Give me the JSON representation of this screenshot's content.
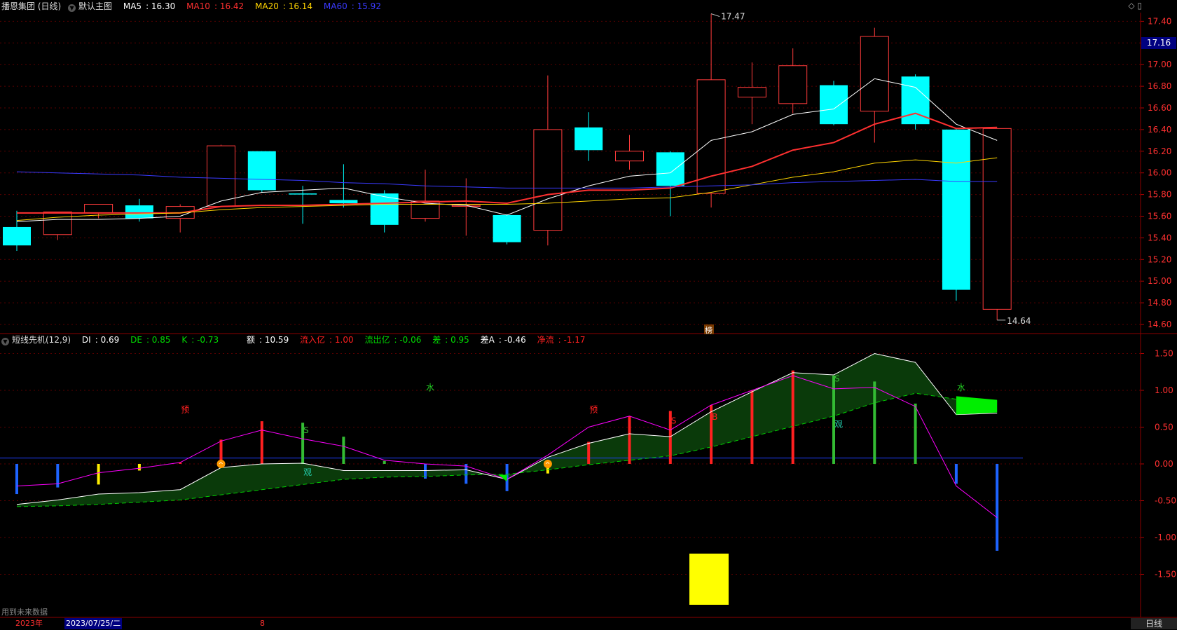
{
  "main": {
    "title": "播恩集团 (日线)",
    "template": "默认主图",
    "ma": [
      {
        "label": "MA5",
        "value": "16.30",
        "color": "#ffffff"
      },
      {
        "label": "MA10",
        "value": "16.42",
        "color": "#ff3030"
      },
      {
        "label": "MA20",
        "value": "16.14",
        "color": "#ffd400"
      },
      {
        "label": "MA60",
        "value": "15.92",
        "color": "#3a3aff"
      }
    ],
    "current_price": "17.16",
    "high_label": "17.47",
    "low_label": "14.64",
    "marker_text": "榜"
  },
  "indicator": {
    "title": "短线先机(12,9)",
    "values": [
      {
        "label": "DI",
        "value": "0.69"
      },
      {
        "label": "DE",
        "value": "0.85"
      },
      {
        "label": "K",
        "value": "-0.73"
      },
      {
        "label": "额",
        "value": "10.59"
      },
      {
        "label": "流入亿",
        "value": "1.00"
      },
      {
        "label": "流出亿",
        "value": "-0.06"
      },
      {
        "label": "差",
        "value": "0.95"
      },
      {
        "label": "差A",
        "value": "-0.46"
      },
      {
        "label": "净流",
        "value": "-1.17"
      }
    ]
  },
  "footer": {
    "note": "用到未来数据",
    "year": "2023年",
    "cursor_date": "2023/07/25/二",
    "month": "8",
    "period": "日线"
  },
  "chart_data": [
    {
      "type": "candlestick",
      "title": "播恩集团 (日线)",
      "ylim": [
        14.5,
        17.5
      ],
      "yticks": [
        14.6,
        14.8,
        15.0,
        15.2,
        15.4,
        15.6,
        15.8,
        16.0,
        16.2,
        16.4,
        16.6,
        16.8,
        17.0,
        17.2,
        17.4
      ],
      "candles": [
        {
          "o": 15.5,
          "h": 15.65,
          "l": 15.28,
          "c": 15.33
        },
        {
          "o": 15.43,
          "h": 15.64,
          "l": 15.38,
          "c": 15.64
        },
        {
          "o": 15.63,
          "h": 15.71,
          "l": 15.58,
          "c": 15.71
        },
        {
          "o": 15.7,
          "h": 15.76,
          "l": 15.55,
          "c": 15.58
        },
        {
          "o": 15.58,
          "h": 15.71,
          "l": 15.45,
          "c": 15.69
        },
        {
          "o": 15.69,
          "h": 16.26,
          "l": 15.69,
          "c": 16.25
        },
        {
          "o": 16.2,
          "h": 16.2,
          "l": 15.82,
          "c": 15.84
        },
        {
          "o": 15.81,
          "h": 15.88,
          "l": 15.53,
          "c": 15.8
        },
        {
          "o": 15.75,
          "h": 16.08,
          "l": 15.68,
          "c": 15.72
        },
        {
          "o": 15.81,
          "h": 15.84,
          "l": 15.45,
          "c": 15.52
        },
        {
          "o": 15.58,
          "h": 16.03,
          "l": 15.55,
          "c": 15.74
        },
        {
          "o": 15.7,
          "h": 15.95,
          "l": 15.42,
          "c": 15.7
        },
        {
          "o": 15.61,
          "h": 15.62,
          "l": 15.34,
          "c": 15.36
        },
        {
          "o": 15.47,
          "h": 16.9,
          "l": 15.33,
          "c": 16.4
        },
        {
          "o": 16.42,
          "h": 16.56,
          "l": 16.11,
          "c": 16.21
        },
        {
          "o": 16.11,
          "h": 16.35,
          "l": 16.03,
          "c": 16.2
        },
        {
          "o": 16.19,
          "h": 16.2,
          "l": 15.6,
          "c": 15.88
        },
        {
          "o": 15.81,
          "h": 17.47,
          "l": 15.68,
          "c": 16.86
        },
        {
          "o": 16.7,
          "h": 17.02,
          "l": 16.45,
          "c": 16.79
        },
        {
          "o": 16.64,
          "h": 17.15,
          "l": 16.55,
          "c": 16.99
        },
        {
          "o": 16.81,
          "h": 16.85,
          "l": 16.44,
          "c": 16.45
        },
        {
          "o": 16.57,
          "h": 17.34,
          "l": 16.28,
          "c": 17.26
        },
        {
          "o": 16.89,
          "h": 16.91,
          "l": 16.4,
          "c": 16.45
        },
        {
          "o": 16.4,
          "h": 16.41,
          "l": 14.82,
          "c": 14.92
        },
        {
          "o": 14.74,
          "h": 16.41,
          "l": 14.64,
          "c": 16.41
        }
      ],
      "series": [
        {
          "name": "MA5",
          "color": "#ffffff",
          "values": [
            15.55,
            15.57,
            15.57,
            15.58,
            15.6,
            15.74,
            15.82,
            15.84,
            15.86,
            15.78,
            15.72,
            15.7,
            15.61,
            15.76,
            15.88,
            15.97,
            16.0,
            16.3,
            16.38,
            16.54,
            16.59,
            16.87,
            16.79,
            16.45,
            16.3
          ]
        },
        {
          "name": "MA10",
          "color": "#ff3030",
          "values": [
            15.63,
            15.63,
            15.63,
            15.63,
            15.63,
            15.69,
            15.7,
            15.7,
            15.71,
            15.72,
            15.73,
            15.74,
            15.72,
            15.8,
            15.84,
            15.84,
            15.86,
            15.97,
            16.06,
            16.21,
            16.28,
            16.45,
            16.55,
            16.41,
            16.42
          ]
        },
        {
          "name": "MA20",
          "color": "#ffd400",
          "values": [
            15.56,
            15.59,
            15.61,
            15.62,
            15.63,
            15.66,
            15.68,
            15.69,
            15.7,
            15.71,
            15.71,
            15.71,
            15.71,
            15.72,
            15.74,
            15.76,
            15.77,
            15.82,
            15.89,
            15.96,
            16.01,
            16.09,
            16.12,
            16.09,
            16.14
          ]
        },
        {
          "name": "MA60",
          "color": "#3a3aff",
          "values": [
            16.01,
            16.0,
            15.99,
            15.98,
            15.96,
            15.95,
            15.94,
            15.93,
            15.91,
            15.9,
            15.88,
            15.87,
            15.86,
            15.86,
            15.86,
            15.86,
            15.87,
            15.88,
            15.89,
            15.91,
            15.92,
            15.93,
            15.94,
            15.92,
            15.92
          ]
        }
      ]
    },
    {
      "type": "indicator",
      "title": "短线先机(12,9)",
      "ylim": [
        -2.0,
        1.65
      ],
      "yticks": [
        -1.5,
        -1.0,
        -0.5,
        0.0,
        0.5,
        1.0,
        1.5
      ],
      "baseline": 0.08,
      "series": [
        {
          "name": "DI",
          "color": "#ffffff",
          "values": [
            -0.55,
            -0.49,
            -0.41,
            -0.39,
            -0.35,
            -0.05,
            0.0,
            0.01,
            -0.09,
            -0.09,
            -0.09,
            -0.08,
            -0.21,
            0.09,
            0.28,
            0.41,
            0.37,
            0.71,
            0.98,
            1.24,
            1.21,
            1.5,
            1.38,
            0.67,
            0.69
          ]
        },
        {
          "name": "DE",
          "color": "#00cc00",
          "values": [
            -0.58,
            -0.57,
            -0.55,
            -0.52,
            -0.49,
            -0.42,
            -0.35,
            -0.28,
            -0.21,
            -0.18,
            -0.17,
            -0.15,
            -0.14,
            -0.08,
            -0.01,
            0.05,
            0.11,
            0.23,
            0.37,
            0.51,
            0.65,
            0.83,
            0.96,
            0.88,
            0.85
          ]
        },
        {
          "name": "K",
          "color": "#ff00ff",
          "values": [
            -0.3,
            -0.27,
            -0.12,
            -0.06,
            0.02,
            0.31,
            0.46,
            0.34,
            0.24,
            0.05,
            0.0,
            -0.03,
            -0.21,
            0.12,
            0.5,
            0.65,
            0.46,
            0.8,
            1.0,
            1.2,
            1.02,
            1.04,
            0.78,
            -0.3,
            -0.73
          ]
        }
      ],
      "bars": [
        {
          "v": -0.41,
          "color": "#1e64ff"
        },
        {
          "v": -0.32,
          "color": "#1e64ff"
        },
        {
          "v": -0.28,
          "color": "#ffee00"
        },
        {
          "v": -0.09,
          "color": "#ffee00"
        },
        {
          "v": 0.02,
          "color": "#ff2020"
        },
        {
          "v": 0.33,
          "color": "#ff2020"
        },
        {
          "v": 0.58,
          "color": "#ff2020"
        },
        {
          "v": 0.56,
          "color": "#33bb33"
        },
        {
          "v": 0.37,
          "color": "#33bb33"
        },
        {
          "v": 0.04,
          "color": "#33bb33"
        },
        {
          "v": -0.2,
          "color": "#1e64ff"
        },
        {
          "v": -0.27,
          "color": "#1e64ff"
        },
        {
          "v": -0.37,
          "color": "#1e64ff"
        },
        {
          "v": -0.13,
          "color": "#ffee00"
        },
        {
          "v": 0.3,
          "color": "#ff2020"
        },
        {
          "v": 0.65,
          "color": "#ff2020"
        },
        {
          "v": 0.72,
          "color": "#ff2020"
        },
        {
          "v": 0.8,
          "color": "#ff2020"
        },
        {
          "v": 1.0,
          "color": "#ff2020"
        },
        {
          "v": 1.27,
          "color": "#ff2020"
        },
        {
          "v": 1.2,
          "color": "#33bb33"
        },
        {
          "v": 1.12,
          "color": "#33bb33"
        },
        {
          "v": 0.82,
          "color": "#33bb33"
        },
        {
          "v": -0.27,
          "color": "#1e64ff"
        },
        {
          "v": -1.18,
          "color": "#1e64ff"
        }
      ],
      "signals": [
        {
          "i": 4,
          "text": "预",
          "color": "#ff2020",
          "v": 0.7
        },
        {
          "i": 10,
          "text": "水",
          "color": "#22cc22",
          "v": 1.0
        },
        {
          "i": 14,
          "text": "预",
          "color": "#ff2020",
          "v": 0.7
        },
        {
          "i": 7,
          "text": "S",
          "color": "#33bb33",
          "v": 0.42
        },
        {
          "i": 7,
          "text": "观",
          "color": "#22ccaa",
          "v": -0.15
        },
        {
          "i": 16,
          "text": "S",
          "color": "#ff2020",
          "v": 0.55
        },
        {
          "i": 17,
          "text": "B",
          "color": "#ff2020",
          "v": 0.6
        },
        {
          "i": 20,
          "text": "S",
          "color": "#33bb33",
          "v": 1.12
        },
        {
          "i": 20,
          "text": "观",
          "color": "#22ccaa",
          "v": 0.5
        },
        {
          "i": 23,
          "text": "水",
          "color": "#22cc22",
          "v": 1.0
        }
      ]
    }
  ]
}
